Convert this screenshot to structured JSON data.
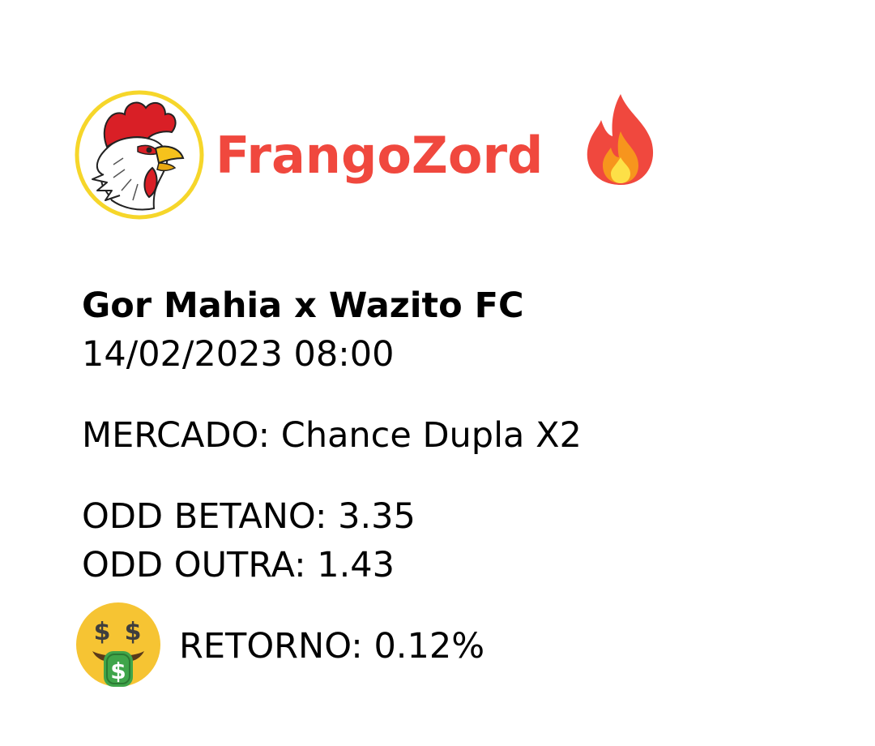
{
  "brand": {
    "name": "FrangoZord",
    "color": "#f0483e",
    "logo_icon": "rooster-logo-icon",
    "badge_icon": "fire-emoji-icon"
  },
  "match": {
    "title": "Gor Mahia x Wazito FC",
    "datetime": "14/02/2023 08:00"
  },
  "market": {
    "text": "MERCADO: Chance Dupla X2"
  },
  "odds": {
    "betano": "ODD BETANO: 3.35",
    "outra": "ODD OUTRA: 1.43"
  },
  "retorno": {
    "text": "RETORNO: 0.12%",
    "icon": "money-mouth-face-emoji-icon"
  }
}
